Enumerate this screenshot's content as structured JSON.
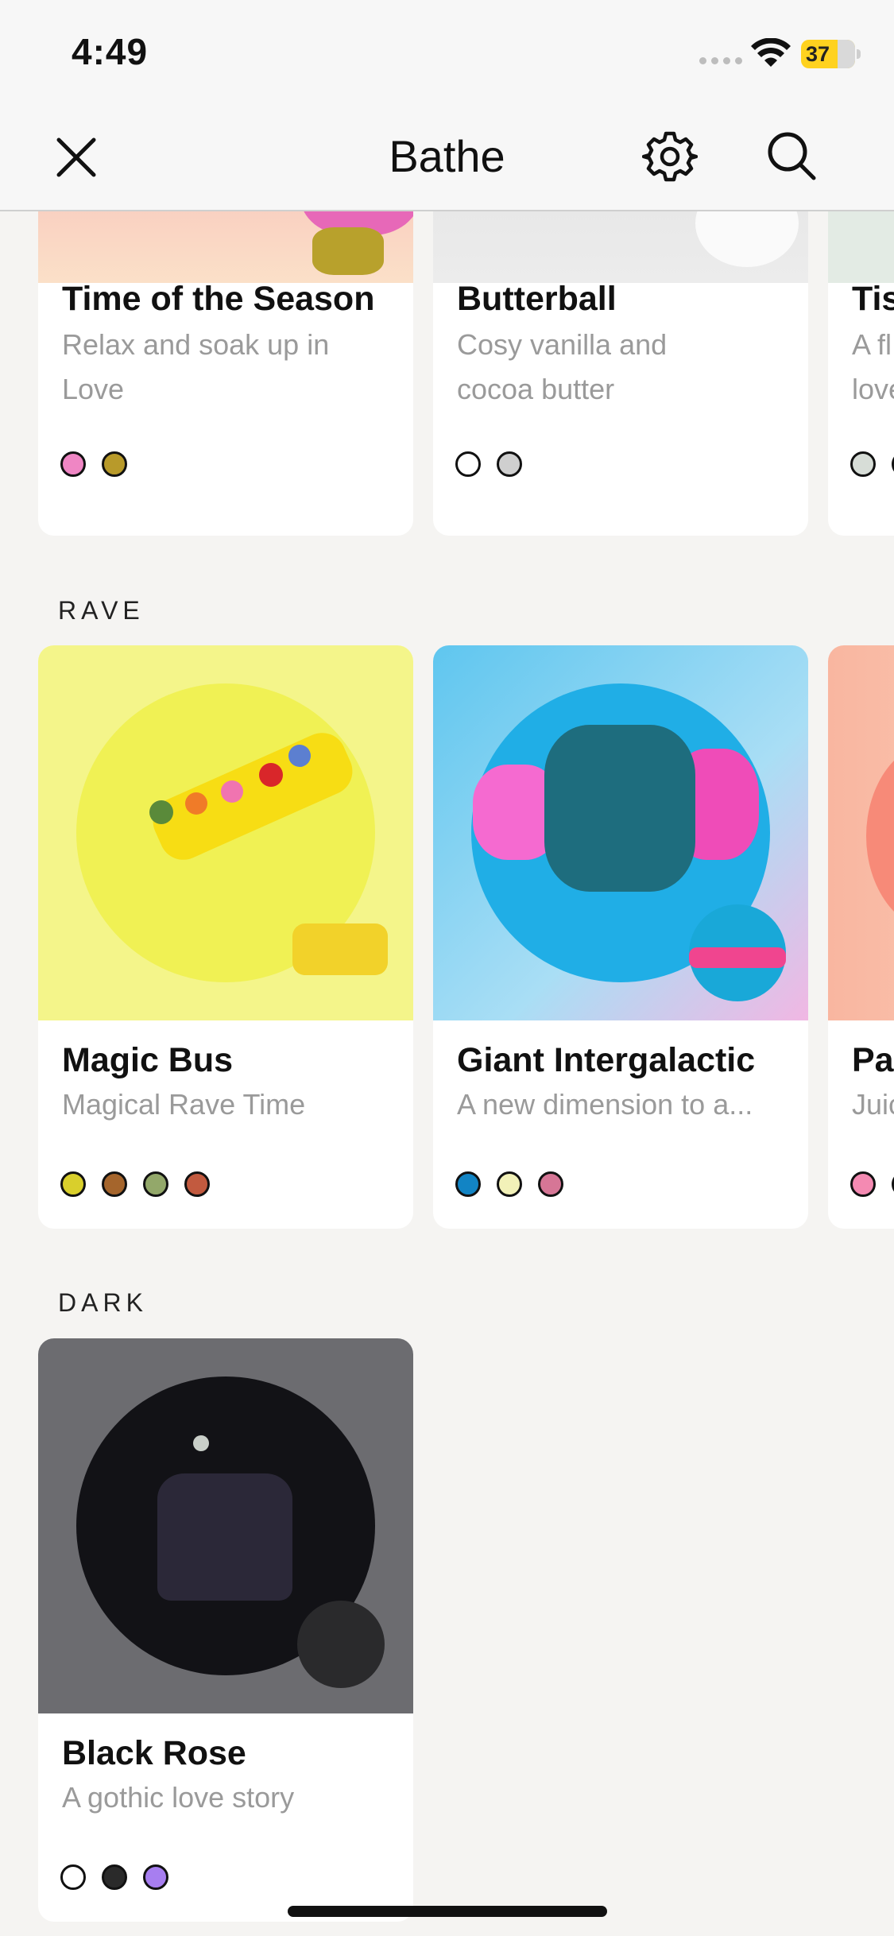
{
  "status_bar": {
    "time": "4:49",
    "battery": "37"
  },
  "nav": {
    "title": "Bathe",
    "close_icon": "close-icon",
    "settings_icon": "gear-icon",
    "search_icon": "search-icon"
  },
  "row_top": {
    "cards": [
      {
        "name": "Time of the Season",
        "desc": "Relax and soak up in Love",
        "colors": [
          "#ef86c4",
          "#b89a2a"
        ]
      },
      {
        "name": "Butterball",
        "desc": "Cosy vanilla and cocoa butter",
        "colors": [
          "#ffffff",
          "#cfcfcf"
        ]
      },
      {
        "name": "Tis",
        "desc": "A fl love",
        "colors": [
          "#d7ddd7",
          "#ffffff"
        ]
      }
    ]
  },
  "sections": [
    {
      "label": "RAVE",
      "cards": [
        {
          "name": "Magic Bus",
          "desc": "Magical Rave Time",
          "colors": [
            "#d9cf2c",
            "#a5652c",
            "#93a86a",
            "#c25a3f"
          ]
        },
        {
          "name": "Giant Intergalactic",
          "desc": "A new dimension to a...",
          "colors": [
            "#1284c4",
            "#f2f1b8",
            "#d67696"
          ]
        },
        {
          "name": "Pas",
          "desc": "Juic",
          "colors": [
            "#f48ab2",
            "#ffffff"
          ]
        }
      ]
    },
    {
      "label": "DARK",
      "cards": [
        {
          "name": "Black Rose",
          "desc": "A gothic love story",
          "colors": [
            "#ffffff",
            "#2a2a2a",
            "#a77ef0"
          ]
        }
      ]
    }
  ]
}
